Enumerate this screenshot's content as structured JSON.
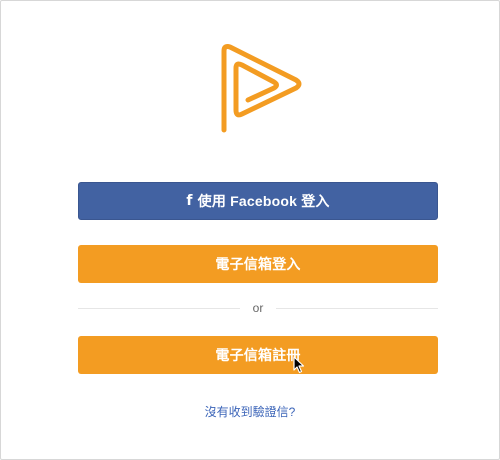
{
  "logo": {
    "icon": "play-logo-icon",
    "color": "#f39c22"
  },
  "buttons": {
    "facebook_login": {
      "icon": "facebook-icon",
      "icon_glyph": "f",
      "label": "使用 Facebook 登入",
      "color": "#4262a2"
    },
    "email_login": {
      "label": "電子信箱登入",
      "color": "#f39c22"
    },
    "email_register": {
      "label": "電子信箱註冊",
      "color": "#f39c22"
    }
  },
  "divider": {
    "text": "or"
  },
  "links": {
    "resend_verification": "沒有收到驗證信?"
  }
}
